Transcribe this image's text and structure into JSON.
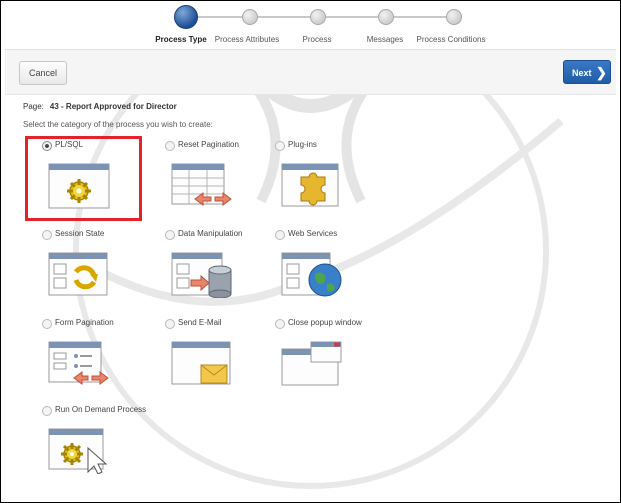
{
  "wizard": {
    "steps": [
      {
        "label": "Process Type",
        "active": true
      },
      {
        "label": "Process Attributes",
        "active": false
      },
      {
        "label": "Process",
        "active": false
      },
      {
        "label": "Messages",
        "active": false
      },
      {
        "label": "Process Conditions",
        "active": false
      }
    ]
  },
  "buttons": {
    "cancel_label": "Cancel",
    "next_label": "Next"
  },
  "page": {
    "label": "Page:",
    "value": "43 - Report Approved for Director"
  },
  "instruction": "Select the category of the process you wish to create:",
  "options": [
    {
      "label": "PL/SQL",
      "icon": "gear-window-icon",
      "checked": true
    },
    {
      "label": "Reset Pagination",
      "icon": "table-arrows-icon",
      "checked": false
    },
    {
      "label": "Plug-ins",
      "icon": "puzzle-window-icon",
      "checked": false
    },
    {
      "label": "Session State",
      "icon": "refresh-window-icon",
      "checked": false
    },
    {
      "label": "Data Manipulation",
      "icon": "database-window-icon",
      "checked": false
    },
    {
      "label": "Web Services",
      "icon": "globe-window-icon",
      "checked": false
    },
    {
      "label": "Form Pagination",
      "icon": "form-arrows-icon",
      "checked": false
    },
    {
      "label": "Send E-Mail",
      "icon": "envelope-window-icon",
      "checked": false
    },
    {
      "label": "Close popup window",
      "icon": "popup-close-icon",
      "checked": false
    },
    {
      "label": "Run On Demand Process",
      "icon": "gear-cursor-icon",
      "checked": false
    }
  ],
  "colors": {
    "accent": "#215ca6",
    "highlight": "#e4222a"
  }
}
